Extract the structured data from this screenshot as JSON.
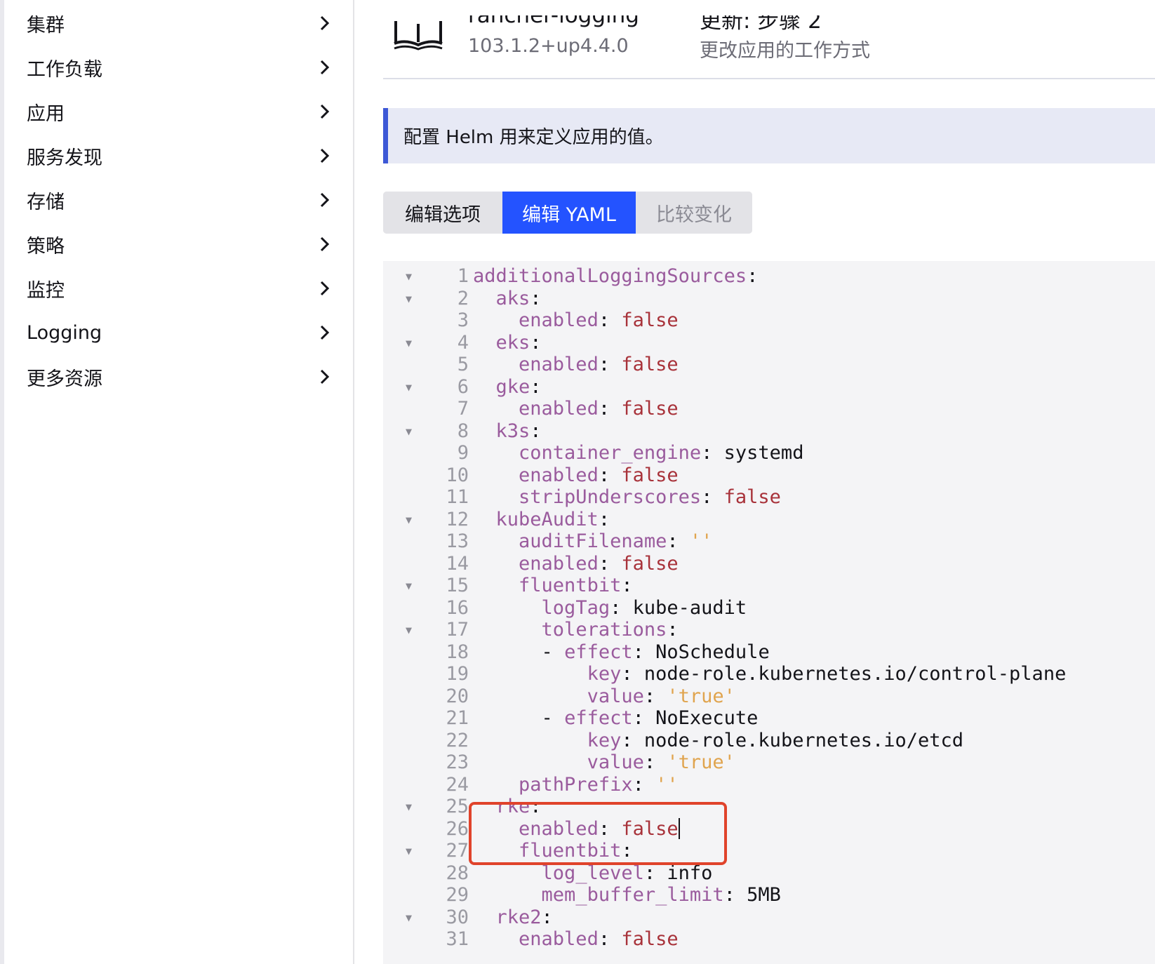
{
  "sidebar": {
    "items": [
      {
        "label": "集群"
      },
      {
        "label": "工作负载"
      },
      {
        "label": "应用"
      },
      {
        "label": "服务发现"
      },
      {
        "label": "存储"
      },
      {
        "label": "策略"
      },
      {
        "label": "监控"
      },
      {
        "label": "Logging"
      },
      {
        "label": "更多资源"
      }
    ]
  },
  "header": {
    "title": "rancher-logging",
    "version": "103.1.2+up4.4.0",
    "step_title": "更新: 步骤 2",
    "subtitle": "更改应用的工作方式"
  },
  "banner": {
    "text": "配置 Helm 用来定义应用的值。"
  },
  "tabs": {
    "edit_options": "编辑选项",
    "edit_yaml": "编辑 YAML",
    "compare_changes": "比较变化"
  },
  "editor": {
    "cursor_line": 26,
    "highlighted_lines": [
      25,
      26
    ],
    "lines": [
      {
        "n": "1",
        "fold": true,
        "indent": 0,
        "key": "additionalLoggingSources",
        "value": "",
        "vtype": ""
      },
      {
        "n": "2",
        "fold": true,
        "indent": 2,
        "key": "aks",
        "value": "",
        "vtype": ""
      },
      {
        "n": "3",
        "fold": false,
        "indent": 4,
        "key": "enabled",
        "value": "false",
        "vtype": "b"
      },
      {
        "n": "4",
        "fold": true,
        "indent": 2,
        "key": "eks",
        "value": "",
        "vtype": ""
      },
      {
        "n": "5",
        "fold": false,
        "indent": 4,
        "key": "enabled",
        "value": "false",
        "vtype": "b"
      },
      {
        "n": "6",
        "fold": true,
        "indent": 2,
        "key": "gke",
        "value": "",
        "vtype": ""
      },
      {
        "n": "7",
        "fold": false,
        "indent": 4,
        "key": "enabled",
        "value": "false",
        "vtype": "b"
      },
      {
        "n": "8",
        "fold": true,
        "indent": 2,
        "key": "k3s",
        "value": "",
        "vtype": ""
      },
      {
        "n": "9",
        "fold": false,
        "indent": 4,
        "key": "container_engine",
        "value": "systemd",
        "vtype": "v"
      },
      {
        "n": "10",
        "fold": false,
        "indent": 4,
        "key": "enabled",
        "value": "false",
        "vtype": "b"
      },
      {
        "n": "11",
        "fold": false,
        "indent": 4,
        "key": "stripUnderscores",
        "value": "false",
        "vtype": "b"
      },
      {
        "n": "12",
        "fold": true,
        "indent": 2,
        "key": "kubeAudit",
        "value": "",
        "vtype": ""
      },
      {
        "n": "13",
        "fold": false,
        "indent": 4,
        "key": "auditFilename",
        "value": "''",
        "vtype": "s"
      },
      {
        "n": "14",
        "fold": false,
        "indent": 4,
        "key": "enabled",
        "value": "false",
        "vtype": "b"
      },
      {
        "n": "15",
        "fold": true,
        "indent": 4,
        "key": "fluentbit",
        "value": "",
        "vtype": ""
      },
      {
        "n": "16",
        "fold": false,
        "indent": 6,
        "key": "logTag",
        "value": "kube-audit",
        "vtype": "v"
      },
      {
        "n": "17",
        "fold": true,
        "indent": 6,
        "key": "tolerations",
        "value": "",
        "vtype": ""
      },
      {
        "n": "18",
        "fold": false,
        "indent": 8,
        "dash": true,
        "key": "effect",
        "value": "NoSchedule",
        "vtype": "v"
      },
      {
        "n": "19",
        "fold": false,
        "indent": 10,
        "key": "key",
        "value": "node-role.kubernetes.io/control-plane",
        "vtype": "v"
      },
      {
        "n": "20",
        "fold": false,
        "indent": 10,
        "key": "value",
        "value": "'true'",
        "vtype": "s"
      },
      {
        "n": "21",
        "fold": false,
        "indent": 8,
        "dash": true,
        "key": "effect",
        "value": "NoExecute",
        "vtype": "v"
      },
      {
        "n": "22",
        "fold": false,
        "indent": 10,
        "key": "key",
        "value": "node-role.kubernetes.io/etcd",
        "vtype": "v"
      },
      {
        "n": "23",
        "fold": false,
        "indent": 10,
        "key": "value",
        "value": "'true'",
        "vtype": "s"
      },
      {
        "n": "24",
        "fold": false,
        "indent": 4,
        "key": "pathPrefix",
        "value": "''",
        "vtype": "s"
      },
      {
        "n": "25",
        "fold": true,
        "indent": 2,
        "key": "rke",
        "value": "",
        "vtype": ""
      },
      {
        "n": "26",
        "fold": false,
        "indent": 4,
        "key": "enabled",
        "value": "false",
        "vtype": "b"
      },
      {
        "n": "27",
        "fold": true,
        "indent": 4,
        "key": "fluentbit",
        "value": "",
        "vtype": ""
      },
      {
        "n": "28",
        "fold": false,
        "indent": 6,
        "key": "log_level",
        "value": "info",
        "vtype": "v"
      },
      {
        "n": "29",
        "fold": false,
        "indent": 6,
        "key": "mem_buffer_limit",
        "value": "5MB",
        "vtype": "v"
      },
      {
        "n": "30",
        "fold": true,
        "indent": 2,
        "key": "rke2",
        "value": "",
        "vtype": ""
      },
      {
        "n": "31",
        "fold": false,
        "indent": 4,
        "key": "enabled",
        "value": "false",
        "vtype": "b"
      }
    ]
  }
}
